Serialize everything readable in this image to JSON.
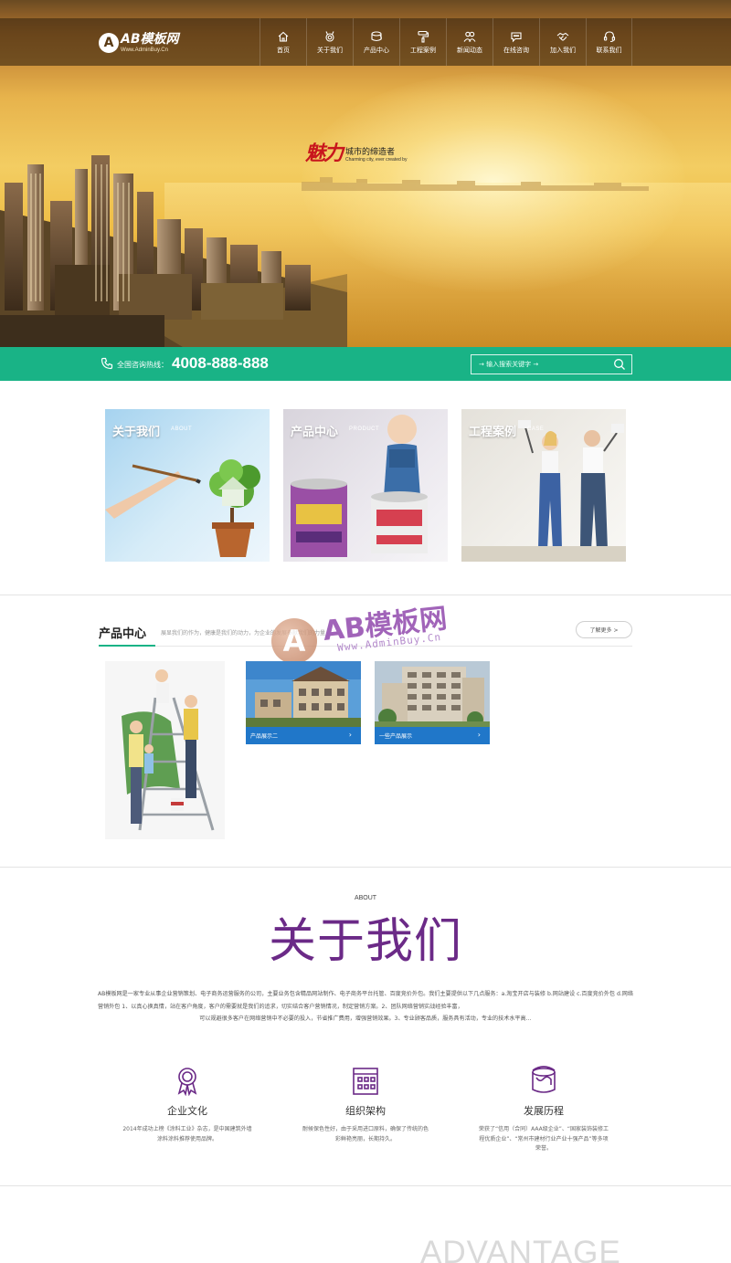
{
  "header": {
    "logo_main": "AB模板网",
    "logo_sub": "Www.AdminBuy.Cn",
    "nav": [
      {
        "label": "首页",
        "icon": "home-icon"
      },
      {
        "label": "关于我们",
        "icon": "medal-icon"
      },
      {
        "label": "产品中心",
        "icon": "paint-bucket-icon"
      },
      {
        "label": "工程案例",
        "icon": "paint-roller-icon"
      },
      {
        "label": "新闻动态",
        "icon": "users-icon"
      },
      {
        "label": "在线咨询",
        "icon": "chat-icon"
      },
      {
        "label": "加入我们",
        "icon": "handshake-icon"
      },
      {
        "label": "联系我们",
        "icon": "headset-icon"
      }
    ]
  },
  "banner": {
    "slogan_main": "魅力",
    "slogan_cn": "城市的缔造者",
    "slogan_en": "Charming city, ever created by"
  },
  "hotline": {
    "label": "全国咨询热线：",
    "number": "4008-888-888",
    "search_placeholder": "→ 输入搜索关键字 →"
  },
  "tiles": [
    {
      "title": "关于我们",
      "en": "ABOUT"
    },
    {
      "title": "产品中心",
      "en": "PRODUCT"
    },
    {
      "title": "工程案例",
      "en": "CASE"
    }
  ],
  "products": {
    "title": "产品中心",
    "desc": "展显我们的作为，健康是我们的动力，为企业的发展奉献我们的力量",
    "more": "了解更多 >",
    "items": [
      {
        "caption": "产品展示二"
      },
      {
        "caption": "一些产品展示"
      }
    ],
    "arrow": "›"
  },
  "watermark": {
    "mark": "A",
    "text": "AB模板网",
    "url": "Www.AdminBuy.Cn"
  },
  "about": {
    "en": "ABOUT",
    "title": "关于我们",
    "body_1": "AB模板网是一家专业从事企业营销策划、电子商务运营服务的公司，主要业务包含精品网站制作、电子商务平台托管、百度竞价外包。我们主要提供以下几点服务：a.淘宝开店与装修 b.网站建设 c.百度竞价外包 d.网络营销外包 1、以真心换真情，站在客户角度，客户的需要就是我们的追求，切实结合客户营销情况，制定营销方案。2、团队网络营销实战经验丰富，",
    "body_2": "可以规避很多客户在网络营销中不必要的投入，节省推广费用，增强营销效果。3、专业顾客品质，服务具有活动，专业的技术水平高…",
    "features": [
      {
        "title": "企业文化",
        "desc": "2014年成功上榜《涂料工业》杂志，是中国建筑外墙涂料涂料推荐使用品牌。",
        "icon": "award-icon"
      },
      {
        "title": "组织架构",
        "desc": "耐候保色性好，由于采用进口原料，确保了传统的色彩鲜艳亮丽，长期持久。",
        "icon": "building-icon"
      },
      {
        "title": "发展历程",
        "desc": "荣获了“信用（合同）AAA级企业”、“国家装饰装修工程优质企业”、“常州市建材行业产业十强产品”等多项荣誉。",
        "icon": "paint-can-icon"
      }
    ]
  },
  "advantage": {
    "en": "ADVANTAGE"
  },
  "colors": {
    "accent_green": "#19b386",
    "caption_blue": "#2077c9",
    "about_purple": "#6b2a87",
    "nav_bg": "#3a2610"
  }
}
